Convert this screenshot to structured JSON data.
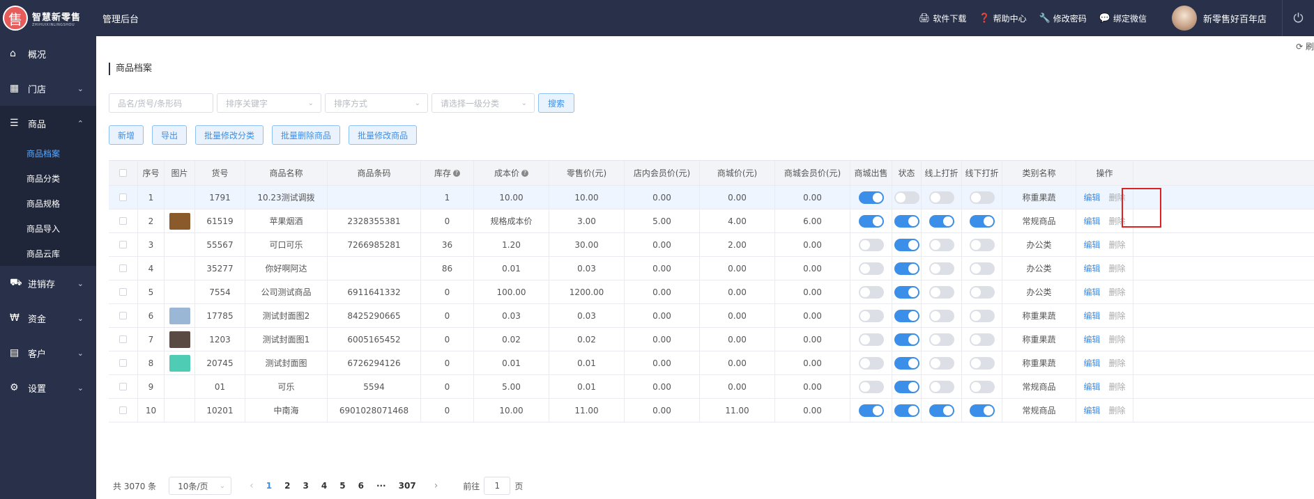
{
  "brand": {
    "logo_cn": "智慧新零售",
    "logo_en": "ZHIHUIXINLINGSHOU",
    "logo_glyph": "售"
  },
  "topbar": {
    "title": "管理后台",
    "links": [
      {
        "icon": "printer-icon",
        "glyph": "🖨",
        "label": "软件下载"
      },
      {
        "icon": "help-icon",
        "glyph": "❓",
        "label": "帮助中心"
      },
      {
        "icon": "key-icon",
        "glyph": "🔧",
        "label": "修改密码"
      },
      {
        "icon": "wechat-icon",
        "glyph": "💬",
        "label": "绑定微信"
      }
    ],
    "store_name": "新零售好百年店",
    "power_glyph": "⏻"
  },
  "sidebar": [
    {
      "label": "概况",
      "glyph": "⌂",
      "chev": ""
    },
    {
      "label": "门店",
      "glyph": "▦",
      "chev": "⌄"
    },
    {
      "label": "商品",
      "glyph": "☰",
      "chev": "⌃",
      "open": true,
      "children": [
        {
          "label": "商品档案",
          "active": true
        },
        {
          "label": "商品分类"
        },
        {
          "label": "商品规格"
        },
        {
          "label": "商品导入"
        },
        {
          "label": "商品云库"
        }
      ]
    },
    {
      "label": "进销存",
      "glyph": "⛟",
      "chev": "⌄"
    },
    {
      "label": "资金",
      "glyph": "₩",
      "chev": "⌄"
    },
    {
      "label": "客户",
      "glyph": "▤",
      "chev": "⌄"
    },
    {
      "label": "设置",
      "glyph": "⚙",
      "chev": "⌄"
    }
  ],
  "refresh_label": "⟳ 刷",
  "page_title": "商品档案",
  "filters": {
    "keyword_placeholder": "品名/货号/条形码",
    "sort_key_placeholder": "排序关键字",
    "sort_order_placeholder": "排序方式",
    "category_placeholder": "请选择一级分类",
    "search_label": "搜索"
  },
  "actions": [
    "新增",
    "导出",
    "批量修改分类",
    "批量删除商品",
    "批量修改商品"
  ],
  "table": {
    "headers": [
      "序号",
      "图片",
      "货号",
      "商品名称",
      "商品条码",
      "库存",
      "成本价",
      "零售价(元)",
      "店内会员价(元)",
      "商城价(元)",
      "商城会员价(元)",
      "商城出售",
      "状态",
      "线上打折",
      "线下打折",
      "类别名称",
      "操作"
    ],
    "edit_label": "编辑",
    "delete_label": "删除",
    "rows": [
      {
        "no": "1",
        "img": "",
        "sku": "1791",
        "name": "10.23测试调拨",
        "barcode": "",
        "stock": "1",
        "cost": "10.00",
        "retail": "10.00",
        "member": "0.00",
        "mall": "0.00",
        "mall_member": "0.00",
        "sw": [
          1,
          0,
          0,
          0
        ],
        "cat": "称重果蔬"
      },
      {
        "no": "2",
        "img": "#8b5a2b",
        "sku": "61519",
        "name": "苹果烟酒",
        "barcode": "2328355381",
        "stock": "0",
        "cost": "规格成本价",
        "retail": "3.00",
        "member": "5.00",
        "mall": "4.00",
        "mall_member": "6.00",
        "sw": [
          1,
          1,
          1,
          1
        ],
        "cat": "常规商品"
      },
      {
        "no": "3",
        "img": "",
        "sku": "55567",
        "name": "可口可乐",
        "barcode": "7266985281",
        "stock": "36",
        "cost": "1.20",
        "retail": "30.00",
        "member": "0.00",
        "mall": "2.00",
        "mall_member": "0.00",
        "sw": [
          0,
          1,
          0,
          0
        ],
        "cat": "办公类"
      },
      {
        "no": "4",
        "img": "",
        "sku": "35277",
        "name": "你好啊阿达",
        "barcode": "",
        "stock": "86",
        "cost": "0.01",
        "retail": "0.03",
        "member": "0.00",
        "mall": "0.00",
        "mall_member": "0.00",
        "sw": [
          0,
          1,
          0,
          0
        ],
        "cat": "办公类"
      },
      {
        "no": "5",
        "img": "",
        "sku": "7554",
        "name": "公司测试商品",
        "barcode": "6911641332",
        "stock": "0",
        "cost": "100.00",
        "retail": "1200.00",
        "member": "0.00",
        "mall": "0.00",
        "mall_member": "0.00",
        "sw": [
          0,
          1,
          0,
          0
        ],
        "cat": "办公类"
      },
      {
        "no": "6",
        "img": "#9ab8d6",
        "sku": "17785",
        "name": "测试封面图2",
        "barcode": "8425290665",
        "stock": "0",
        "cost": "0.03",
        "retail": "0.03",
        "member": "0.00",
        "mall": "0.00",
        "mall_member": "0.00",
        "sw": [
          0,
          1,
          0,
          0
        ],
        "cat": "称重果蔬"
      },
      {
        "no": "7",
        "img": "#5a4a44",
        "sku": "1203",
        "name": "测试封面图1",
        "barcode": "6005165452",
        "stock": "0",
        "cost": "0.02",
        "retail": "0.02",
        "member": "0.00",
        "mall": "0.00",
        "mall_member": "0.00",
        "sw": [
          0,
          1,
          0,
          0
        ],
        "cat": "称重果蔬"
      },
      {
        "no": "8",
        "img": "#4ecdb4",
        "sku": "20745",
        "name": "测试封面图",
        "barcode": "6726294126",
        "stock": "0",
        "cost": "0.01",
        "retail": "0.01",
        "member": "0.00",
        "mall": "0.00",
        "mall_member": "0.00",
        "sw": [
          0,
          1,
          0,
          0
        ],
        "cat": "称重果蔬"
      },
      {
        "no": "9",
        "img": "",
        "sku": "01",
        "name": "可乐",
        "barcode": "5594",
        "stock": "0",
        "cost": "5.00",
        "retail": "0.01",
        "member": "0.00",
        "mall": "0.00",
        "mall_member": "0.00",
        "sw": [
          0,
          1,
          0,
          0
        ],
        "cat": "常规商品"
      },
      {
        "no": "10",
        "img": "",
        "sku": "10201",
        "name": "中南海",
        "barcode": "6901028071468",
        "stock": "0",
        "cost": "10.00",
        "retail": "11.00",
        "member": "0.00",
        "mall": "11.00",
        "mall_member": "0.00",
        "sw": [
          1,
          1,
          1,
          1
        ],
        "cat": "常规商品"
      }
    ]
  },
  "pager": {
    "total": "共 3070 条",
    "page_size": "10条/页",
    "pages": [
      "1",
      "2",
      "3",
      "4",
      "5",
      "6",
      "···",
      "307"
    ],
    "goto_label": "前往",
    "goto_value": "1",
    "unit": "页",
    "prev": "‹",
    "next": "›"
  }
}
